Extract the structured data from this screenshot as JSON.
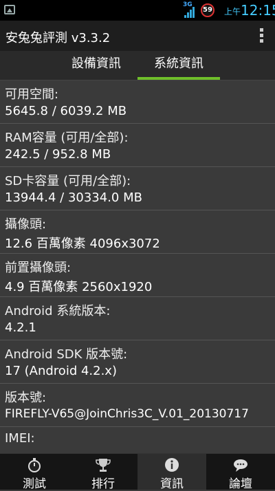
{
  "status_bar": {
    "network": "3G",
    "battery": "59",
    "ampm": "上午",
    "time": "12:15"
  },
  "app": {
    "title": "安兔兔評測 v3.3.2"
  },
  "tabs": [
    {
      "label": "設備資訊"
    },
    {
      "label": "系統資訊",
      "selected": true
    }
  ],
  "info": [
    {
      "label": "可用空間:",
      "value": "5645.8 / 6039.2 MB"
    },
    {
      "label": "RAM容量 (可用/全部):",
      "value": "242.5 / 952.8 MB"
    },
    {
      "label": "SD卡容量 (可用/全部):",
      "value": "13944.4 / 30334.0 MB"
    },
    {
      "label": "攝像頭:",
      "value": "12.6 百萬像素   4096x3072"
    },
    {
      "label": "前置攝像頭:",
      "value": "4.9 百萬像素   2560x1920"
    },
    {
      "label": "Android 系統版本:",
      "value": "4.2.1"
    },
    {
      "label": "Android SDK 版本號:",
      "value": "17  (Android 4.2.x)"
    },
    {
      "label": "版本號:",
      "value": "FIREFLY-V65@JoinChris3C_V.01_20130717"
    },
    {
      "label": "IMEI:",
      "value": ""
    }
  ],
  "bottom_nav": [
    {
      "label": "測試",
      "icon": "stopwatch-icon"
    },
    {
      "label": "排行",
      "icon": "trophy-icon"
    },
    {
      "label": "資訊",
      "icon": "info-icon",
      "active": true
    },
    {
      "label": "論壇",
      "icon": "chat-icon"
    }
  ],
  "colors": {
    "accent": "#6fbf2a",
    "status_blue": "#44ccff"
  }
}
